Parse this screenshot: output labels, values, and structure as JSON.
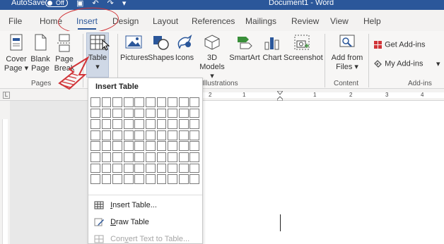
{
  "titlebar": {
    "autosave_label": "AutoSave",
    "autosave_state": "Off",
    "doc_title": "Document1  -  Word"
  },
  "tabs": [
    {
      "label": "File"
    },
    {
      "label": "Home"
    },
    {
      "label": "Insert",
      "active": true
    },
    {
      "label": "Design"
    },
    {
      "label": "Layout"
    },
    {
      "label": "References"
    },
    {
      "label": "Mailings"
    },
    {
      "label": "Review"
    },
    {
      "label": "View"
    },
    {
      "label": "Help"
    }
  ],
  "ribbon": {
    "pages": {
      "cover_page_line1": "Cover",
      "cover_page_line2": "Page ▾",
      "blank_page_line1": "Blank",
      "blank_page_line2": "Page",
      "page_break_line1": "Page",
      "page_break_line2": "Break",
      "group_label": "Pages"
    },
    "tables": {
      "table_label": "Table",
      "table_chevron": "▾"
    },
    "illustrations": {
      "pictures": "Pictures",
      "shapes": "Shapes",
      "icons": "Icons",
      "models_line1": "3D",
      "models_line2": "Models ▾",
      "smartart": "SmartArt",
      "chart": "Chart",
      "screenshot": "Screenshot",
      "group_label": "Illustrations"
    },
    "content": {
      "add_from_line1": "Add from",
      "add_from_line2": "Files ▾",
      "group_label": "Content"
    },
    "addins": {
      "get_addins": "Get Add-ins",
      "my_addins": "My Add-ins",
      "group_label": "Add-ins"
    }
  },
  "ruler": {
    "numbers": [
      "2",
      "1",
      "1",
      "2",
      "3",
      "4"
    ]
  },
  "dropdown": {
    "title": "Insert Table",
    "grid_cols": 10,
    "grid_rows": 8,
    "items": [
      {
        "label": "Insert Table...",
        "underline": "I",
        "enabled": true
      },
      {
        "label": "Draw Table",
        "underline": "D",
        "enabled": true
      },
      {
        "label": "Convert Text to Table...",
        "underline": "v",
        "enabled": false
      }
    ]
  },
  "colors": {
    "accent": "#2b579a",
    "annotation_red": "#d13438"
  }
}
